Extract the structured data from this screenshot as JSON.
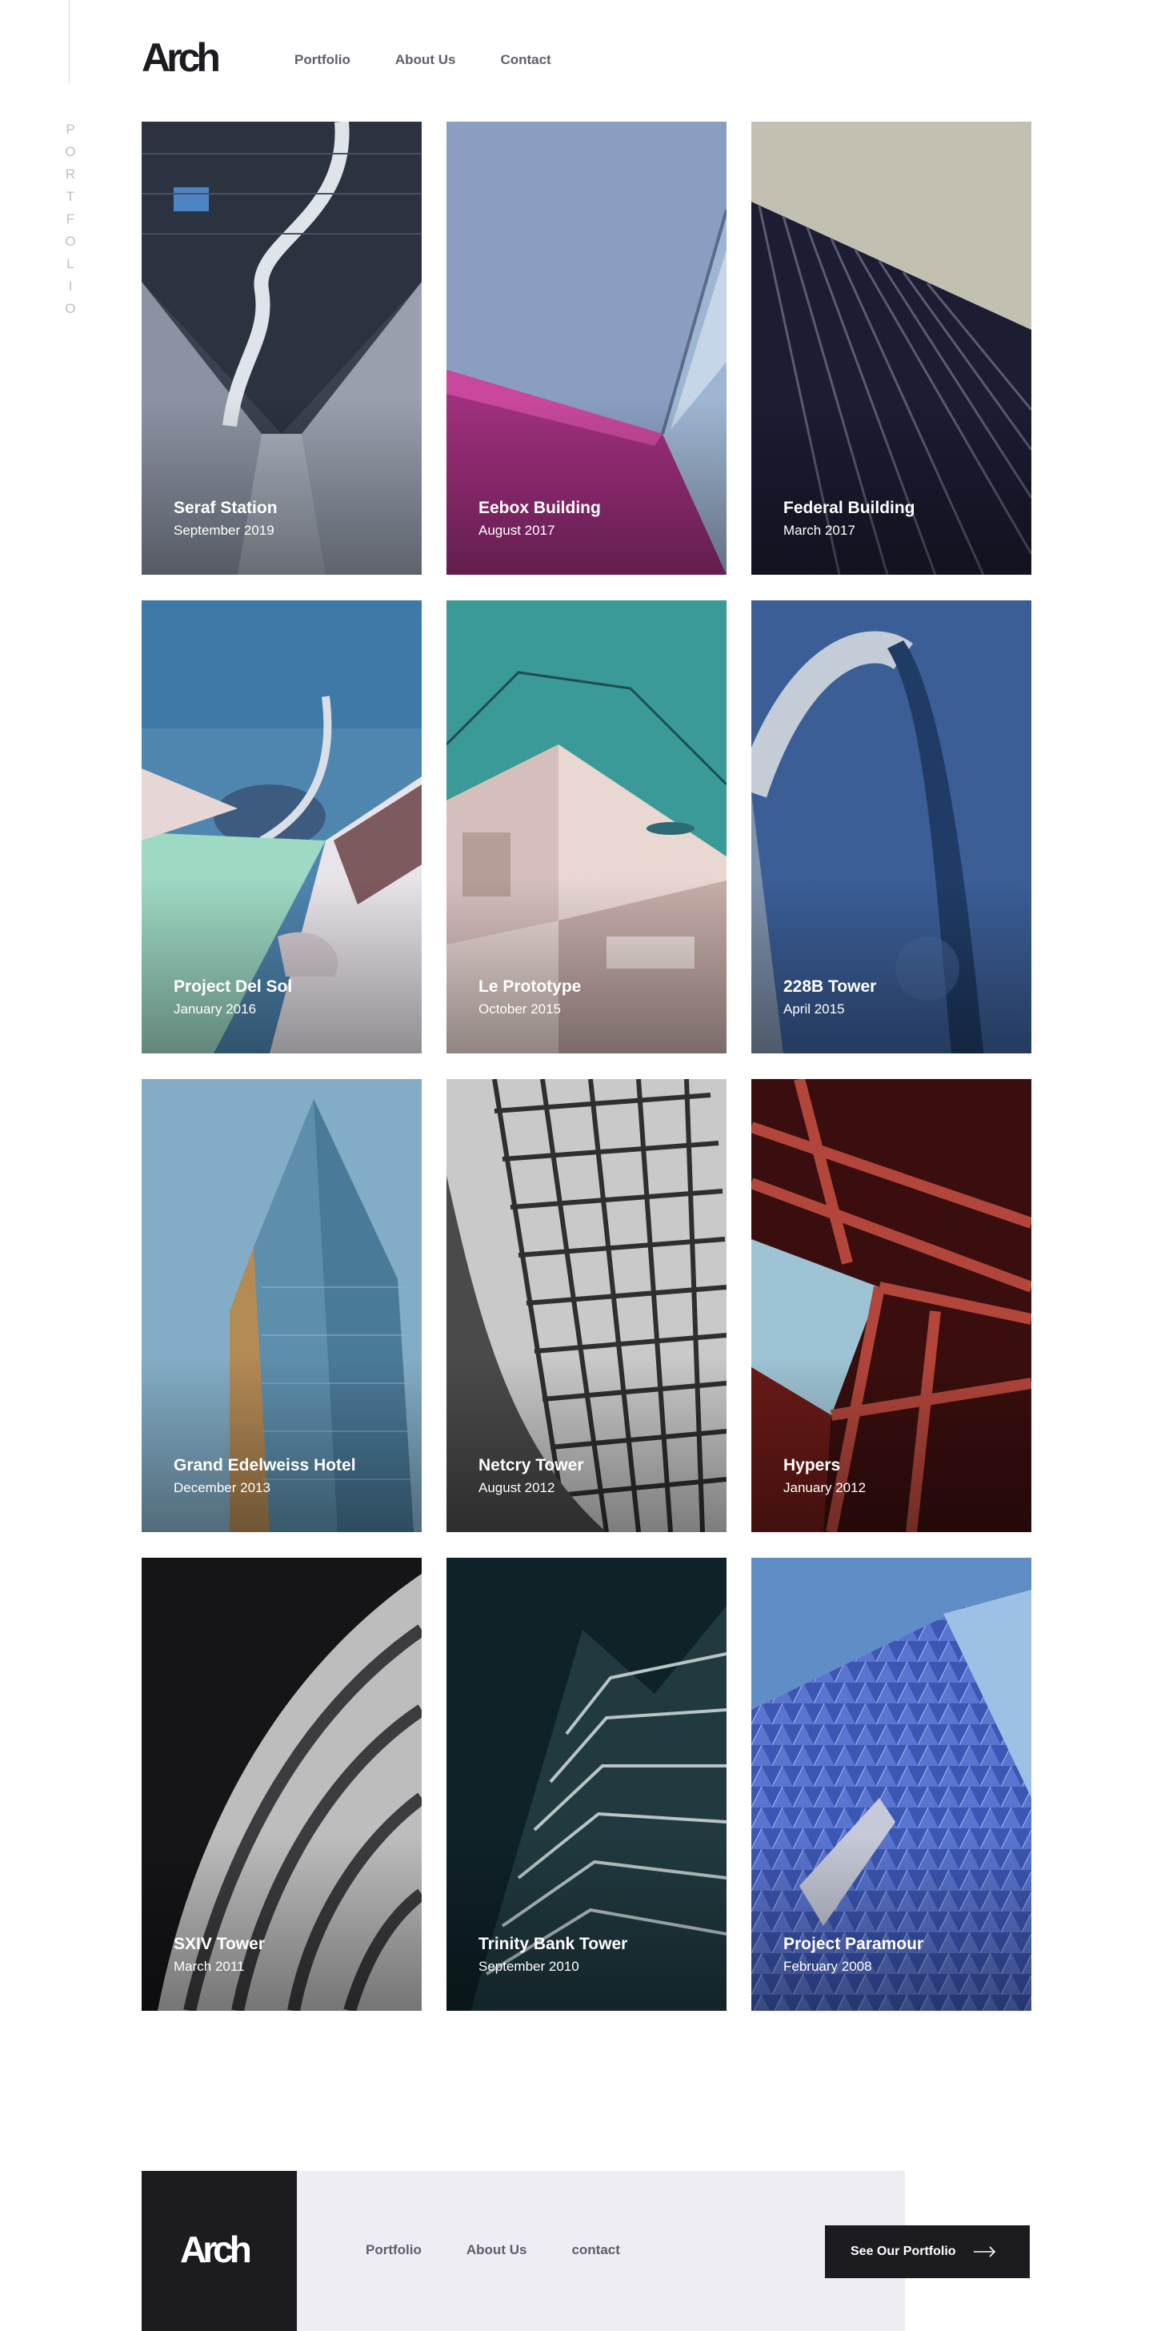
{
  "brand": {
    "logo": "Arch"
  },
  "side_label": "PORTFOLIO",
  "nav": {
    "items": [
      "Portfolio",
      "About Us",
      "Contact"
    ]
  },
  "projects": [
    {
      "title": "Seraf Station",
      "date": "September 2019"
    },
    {
      "title": "Eebox Building",
      "date": "August 2017"
    },
    {
      "title": "Federal Building",
      "date": "March 2017"
    },
    {
      "title": "Project Del Sol",
      "date": "January 2016"
    },
    {
      "title": "Le Prototype",
      "date": "October 2015"
    },
    {
      "title": "228B Tower",
      "date": "April 2015"
    },
    {
      "title": "Grand Edelweiss Hotel",
      "date": "December 2013"
    },
    {
      "title": "Netcry Tower",
      "date": "August 2012"
    },
    {
      "title": "Hypers",
      "date": "January 2012"
    },
    {
      "title": "SXIV Tower",
      "date": "March 2011"
    },
    {
      "title": "Trinity Bank Tower",
      "date": "September 2010"
    },
    {
      "title": "Project Paramour",
      "date": "February 2008"
    }
  ],
  "footer": {
    "logo": "Arch",
    "nav": [
      "Portfolio",
      "About Us",
      "contact"
    ],
    "cta_label": "See Our Portfolio"
  }
}
